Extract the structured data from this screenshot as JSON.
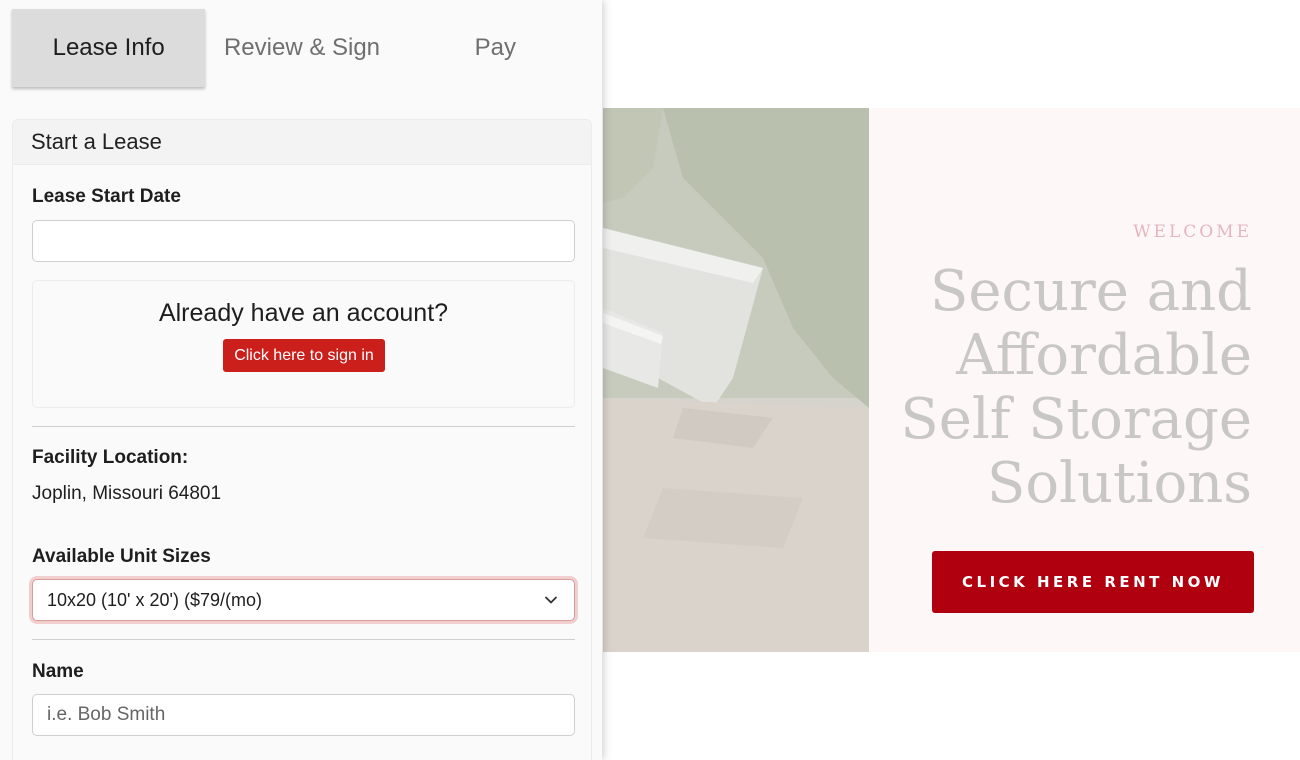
{
  "tabs": [
    {
      "label": "Lease Info",
      "active": true
    },
    {
      "label": "Review & Sign",
      "active": false
    },
    {
      "label": "Pay",
      "active": false
    }
  ],
  "form": {
    "header": "Start a Lease",
    "lease_start_label": "Lease Start Date",
    "lease_start_value": "",
    "account_prompt": "Already have an account?",
    "signin_label": "Click here to sign in",
    "facility_label": "Facility Location:",
    "facility_value": "Joplin, Missouri 64801",
    "unit_sizes_label": "Available Unit Sizes",
    "unit_size_selected": "10x20 (10' x 20') ($79/(mo)",
    "name_label": "Name",
    "name_placeholder": "i.e. Bob Smith"
  },
  "hero": {
    "welcome": "WELCOME",
    "headline_lines": [
      "Secure and",
      "Affordable",
      "Self Storage",
      "Solutions"
    ],
    "cta_label": "CLICK HERE RENT NOW"
  },
  "colors": {
    "cta": "#b0000f",
    "signin": "#cb1f1c",
    "active_tab": "#dcdcdc",
    "welcome": "#e5b6bd"
  }
}
